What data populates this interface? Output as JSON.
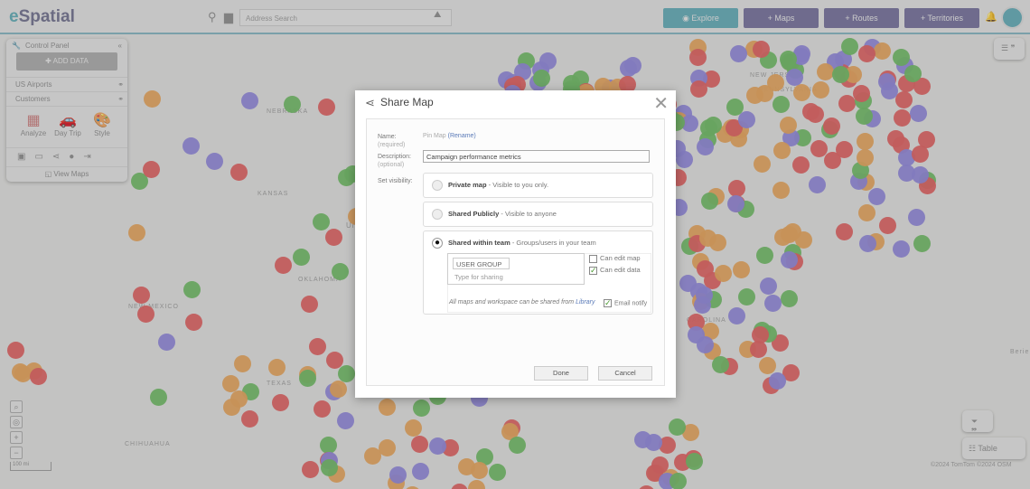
{
  "app": {
    "logo_e": "e",
    "logo_rest": "Spatial"
  },
  "header": {
    "search_placeholder": "Address Search",
    "explore": "Explore",
    "maps": "+ Maps",
    "routes": "+ Routes",
    "territories": "+ Territories",
    "colors": {
      "explore": "#5aa9b6",
      "nav": "#6f6a99"
    }
  },
  "control_panel": {
    "title": "Control Panel",
    "add_data": "ADD DATA",
    "layers": [
      "US Airports",
      "Customers"
    ],
    "tools": [
      "Analyze",
      "Day Trip",
      "Style"
    ],
    "view_maps": "View Maps"
  },
  "map": {
    "labels": [
      "NEBRASKA",
      "KANSAS",
      "OKLAHOMA",
      "TEXAS",
      "NEW MEXICO",
      "CHIHUAHUA",
      "PENNSYLVANIA",
      "NEW JERSEY",
      "CAROLINA",
      "Uni",
      "Berie"
    ],
    "scale": "100 mi",
    "attribution": "©2024 TomTom ©2024 OSM",
    "table": "Table",
    "dot_colors": [
      "#e25555",
      "#8a80dc",
      "#e9a050",
      "#66b85a"
    ]
  },
  "dialog": {
    "title": "Share Map",
    "name_label": "Name:",
    "name_req": "(required)",
    "name_value": "Pin Map",
    "rename": "(Rename)",
    "desc_label": "Description:",
    "desc_opt": "(optional)",
    "desc_value": "Campaign performance metrics",
    "visibility_label": "Set visibility:",
    "options": [
      {
        "title": "Private map",
        "desc": " - Visible to you only.",
        "selected": false
      },
      {
        "title": "Shared Publicly",
        "desc": " - Visible to anyone",
        "selected": false
      },
      {
        "title": "Shared within team",
        "desc": " - Groups/users in your team",
        "selected": true
      }
    ],
    "user_group": "USER GROUP",
    "type_placeholder": "Type for sharing",
    "can_edit_map": "Can edit map",
    "can_edit_data": "Can edit data",
    "can_edit_map_checked": false,
    "can_edit_data_checked": true,
    "note": "All maps and workspace can be shared from ",
    "library": "Library",
    "email_notify": "Email notify",
    "email_notify_checked": true,
    "done": "Done",
    "cancel": "Cancel"
  }
}
